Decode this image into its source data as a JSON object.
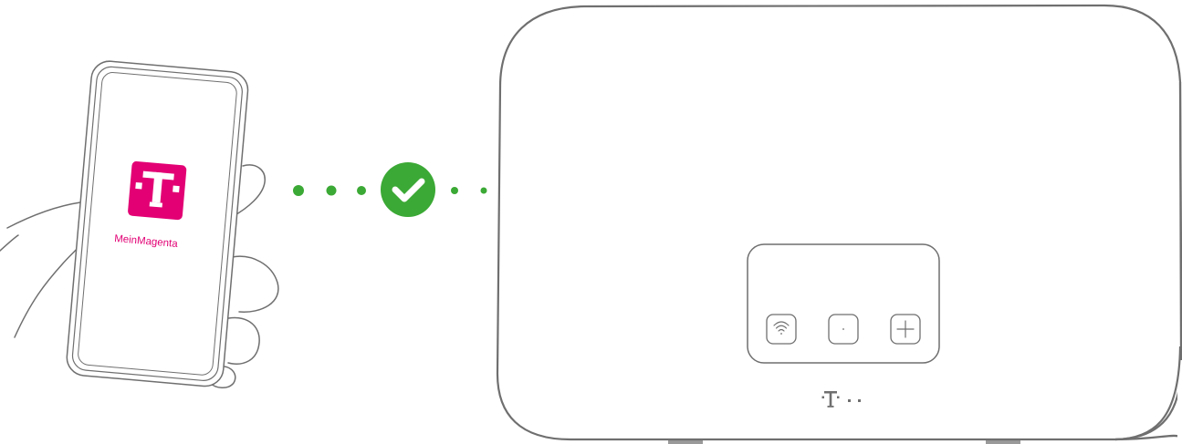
{
  "app": {
    "name": "MeinMagenta",
    "icon": "telekom-t-logo",
    "icon_color": "#E20074"
  },
  "connection": {
    "status": "connected",
    "status_icon": "checkmark-icon",
    "status_color": "#3BA935",
    "dot_color": "#3BA935"
  },
  "router": {
    "buttons": [
      {
        "icon": "wifi-icon"
      },
      {
        "icon": "dot-icon"
      },
      {
        "icon": "plus-icon"
      }
    ],
    "brand_logo": "telekom-t-logo"
  },
  "colors": {
    "outline": "#6f6f6f",
    "magenta": "#E20074",
    "green": "#3BA935"
  }
}
